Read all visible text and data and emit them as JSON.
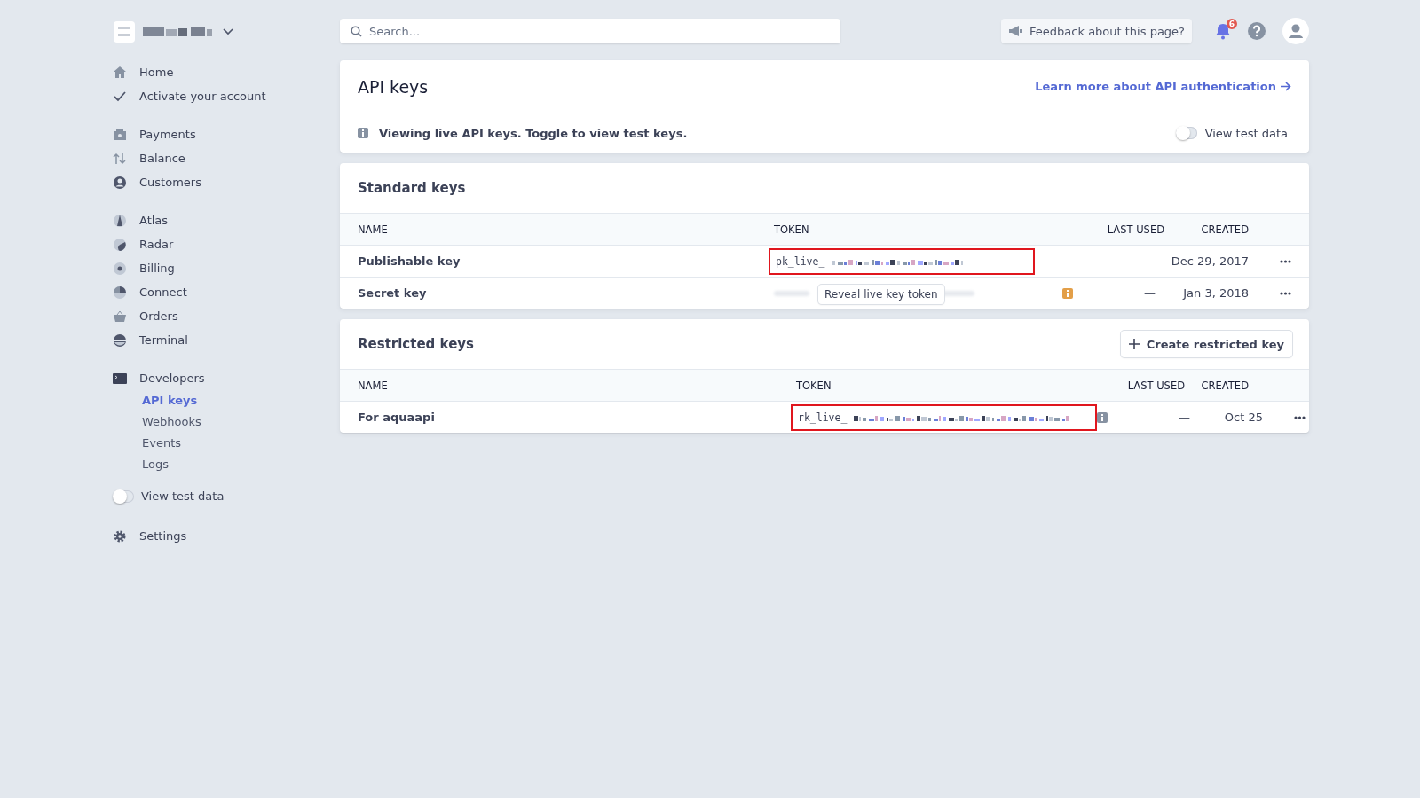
{
  "sidebar": {
    "groups": [
      {
        "items": [
          {
            "label": "Home",
            "selected": false
          },
          {
            "label": "Activate your account",
            "selected": false
          }
        ]
      },
      {
        "items": [
          {
            "label": "Payments",
            "selected": false
          },
          {
            "label": "Balance",
            "selected": false
          },
          {
            "label": "Customers",
            "selected": false
          }
        ]
      },
      {
        "items": [
          {
            "label": "Atlas",
            "selected": false
          },
          {
            "label": "Radar",
            "selected": false
          },
          {
            "label": "Billing",
            "selected": false
          },
          {
            "label": "Connect",
            "selected": false
          },
          {
            "label": "Orders",
            "selected": false
          },
          {
            "label": "Terminal",
            "selected": false
          }
        ]
      },
      {
        "items": [
          {
            "label": "Developers",
            "selected": false,
            "children": [
              {
                "label": "API keys",
                "selected": true
              },
              {
                "label": "Webhooks",
                "selected": false
              },
              {
                "label": "Events",
                "selected": false
              },
              {
                "label": "Logs",
                "selected": false
              }
            ]
          }
        ]
      }
    ],
    "test_toggle": {
      "label": "View test data",
      "on": false
    },
    "settings": {
      "label": "Settings"
    }
  },
  "topbar": {
    "search": {
      "placeholder": "Search..."
    },
    "feedback": "Feedback about this page?",
    "notifications": "6"
  },
  "api_card": {
    "title": "API keys",
    "link": "Learn more about API authentication",
    "notice": "Viewing live API keys. Toggle to view test keys.",
    "toggle": {
      "label": "View test data",
      "on": false
    }
  },
  "standard_keys": {
    "title": "Standard keys",
    "columns": [
      "NAME",
      "TOKEN",
      "LAST USED",
      "CREATED"
    ],
    "rows": [
      {
        "name": "Publishable key",
        "kind": "visible",
        "token": "pk_live_",
        "highlighted": true,
        "last_used": "—",
        "created": "Dec 29, 2017"
      },
      {
        "name": "Secret key",
        "kind": "hidden",
        "reveal": "Reveal live key token",
        "info_icon": {
          "color": "#e39f48"
        },
        "last_used": "—",
        "created": "Jan 3, 2018"
      }
    ]
  },
  "restricted_keys": {
    "title": "Restricted keys",
    "button": "Create restricted key",
    "columns": [
      "NAME",
      "TOKEN",
      "LAST USED",
      "CREATED"
    ],
    "rows": [
      {
        "name": "For aquaapi",
        "kind": "visible",
        "token": "rk_live_",
        "highlighted": true,
        "info_icon": {
          "color": "#8792a2"
        },
        "last_used": "—",
        "created": "Oct 25"
      }
    ]
  }
}
